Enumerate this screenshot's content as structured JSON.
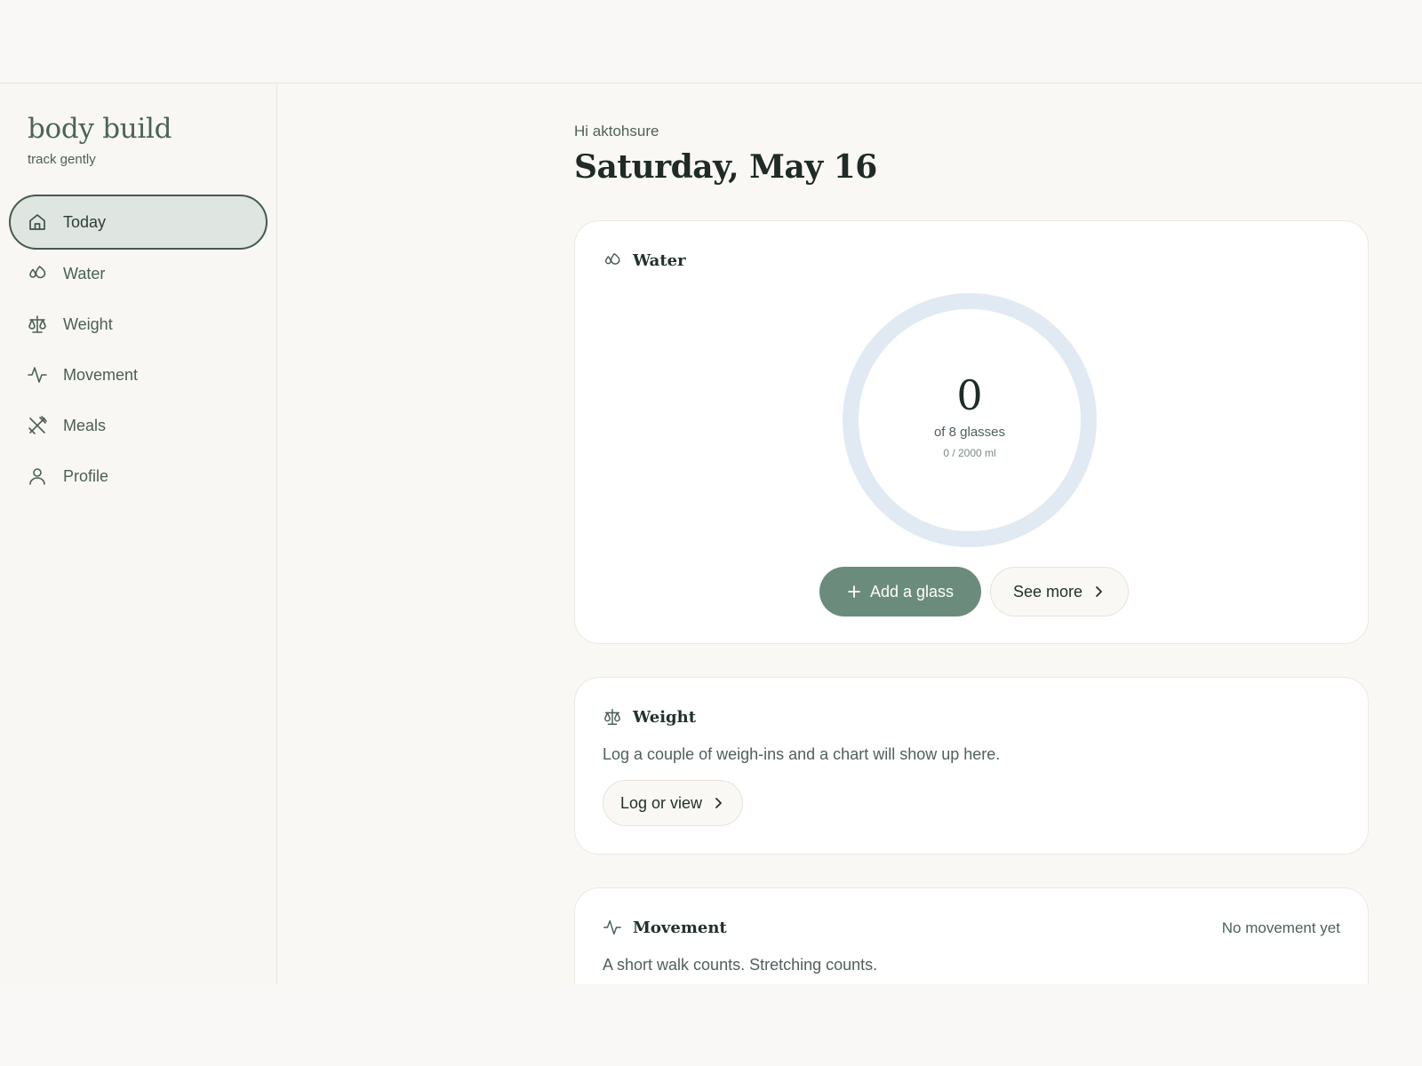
{
  "brand": {
    "title": "body build",
    "subtitle": "track gently"
  },
  "sidebar": {
    "items": [
      {
        "label": "Today",
        "icon": "home-icon",
        "active": true
      },
      {
        "label": "Water",
        "icon": "droplets-icon",
        "active": false
      },
      {
        "label": "Weight",
        "icon": "scale-icon",
        "active": false
      },
      {
        "label": "Movement",
        "icon": "activity-icon",
        "active": false
      },
      {
        "label": "Meals",
        "icon": "utensils-icon",
        "active": false
      },
      {
        "label": "Profile",
        "icon": "user-icon",
        "active": false
      }
    ]
  },
  "header": {
    "greeting": "Hi aktohsure",
    "date": "Saturday, May 16"
  },
  "water": {
    "title": "Water",
    "icon": "droplets-icon",
    "count": "0",
    "of_label": "of 8 glasses",
    "ml_label": "0 / 2000 ml",
    "progress": 0,
    "add_button": "Add a glass",
    "more_button": "See more"
  },
  "weight": {
    "title": "Weight",
    "icon": "scale-icon",
    "description": "Log a couple of weigh-ins and a chart will show up here.",
    "button": "Log or view"
  },
  "movement": {
    "title": "Movement",
    "icon": "activity-icon",
    "status": "No movement yet",
    "description": "A short walk counts. Stretching counts."
  },
  "colors": {
    "accent": "#6b8c7c",
    "active_nav_bg": "#dfe5e0",
    "ring_track": "#e1eaf3",
    "background": "#faf8f5"
  }
}
